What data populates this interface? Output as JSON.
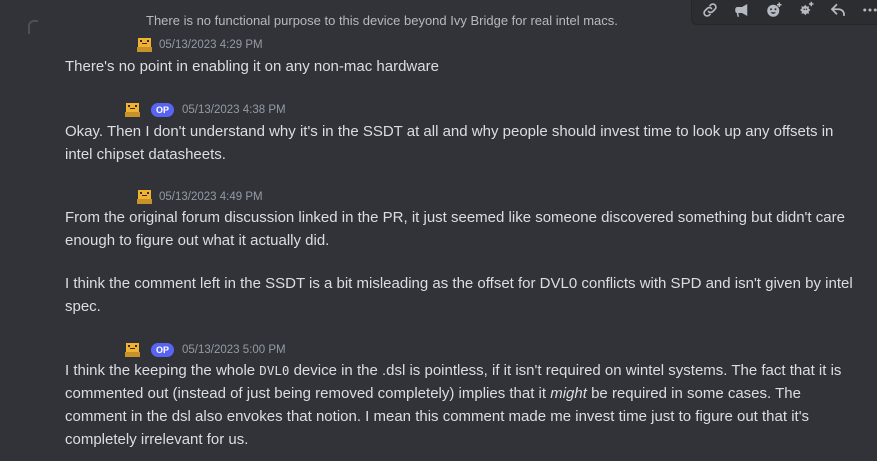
{
  "reply_preview": {
    "text": "There is no functional purpose to this device beyond Ivy Bridge for real intel macs."
  },
  "toolbar": {
    "icons": [
      "link-icon",
      "megaphone-icon",
      "add-reaction-icon",
      "add-super-reaction-icon",
      "reply-icon",
      "more-icon"
    ]
  },
  "messages": [
    {
      "op": false,
      "op_label": "",
      "timestamp": "05/13/2023 4:29 PM",
      "paragraphs": [
        "There's no point in enabling it on any non-mac hardware"
      ]
    },
    {
      "op": true,
      "op_label": "OP",
      "timestamp": "05/13/2023 4:38 PM",
      "paragraphs": [
        "Okay. Then I don't understand why it's in the SSDT at all and why people should invest time to look up any offsets in intel chipset datasheets."
      ]
    },
    {
      "op": false,
      "op_label": "",
      "timestamp": "05/13/2023 4:49 PM",
      "paragraphs": [
        "From the original forum discussion linked in the PR, it just seemed like someone discovered something but didn't care enough to figure out what it actually did.",
        "I think the comment left in the SSDT is a bit misleading as the offset for DVL0 conflicts with SPD and isn't given by intel spec."
      ]
    },
    {
      "op": true,
      "op_label": "OP",
      "timestamp": "05/13/2023 5:00 PM",
      "segments": {
        "a": "I think the keeping the whole ",
        "code": "DVL0",
        "b": " device in the .dsl is pointless, if it isn't required on wintel systems. The fact that it is commented out (instead of just being removed completely) implies that it ",
        "em": "might",
        "c": " be required in some cases. The comment in the dsl also envokes that notion. I mean this comment made me invest time just to figure out that it's completely irrelevant  for us."
      }
    }
  ]
}
